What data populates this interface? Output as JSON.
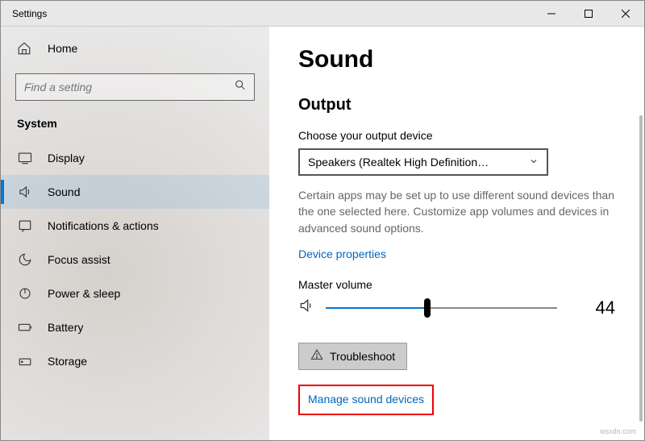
{
  "window": {
    "title": "Settings"
  },
  "sidebar": {
    "home_label": "Home",
    "search_placeholder": "Find a setting",
    "category": "System",
    "items": [
      {
        "label": "Display"
      },
      {
        "label": "Sound"
      },
      {
        "label": "Notifications & actions"
      },
      {
        "label": "Focus assist"
      },
      {
        "label": "Power & sleep"
      },
      {
        "label": "Battery"
      },
      {
        "label": "Storage"
      }
    ]
  },
  "page": {
    "title": "Sound",
    "section_output": "Output",
    "choose_label": "Choose your output device",
    "dropdown_value": "Speakers (Realtek High Definition…",
    "help_text": "Certain apps may be set up to use different sound devices than the one selected here. Customize app volumes and devices in advanced sound options.",
    "device_properties": "Device properties",
    "volume_label": "Master volume",
    "volume_value": "44",
    "troubleshoot": "Troubleshoot",
    "manage_devices": "Manage sound devices"
  },
  "watermark": "wsxdn.com"
}
